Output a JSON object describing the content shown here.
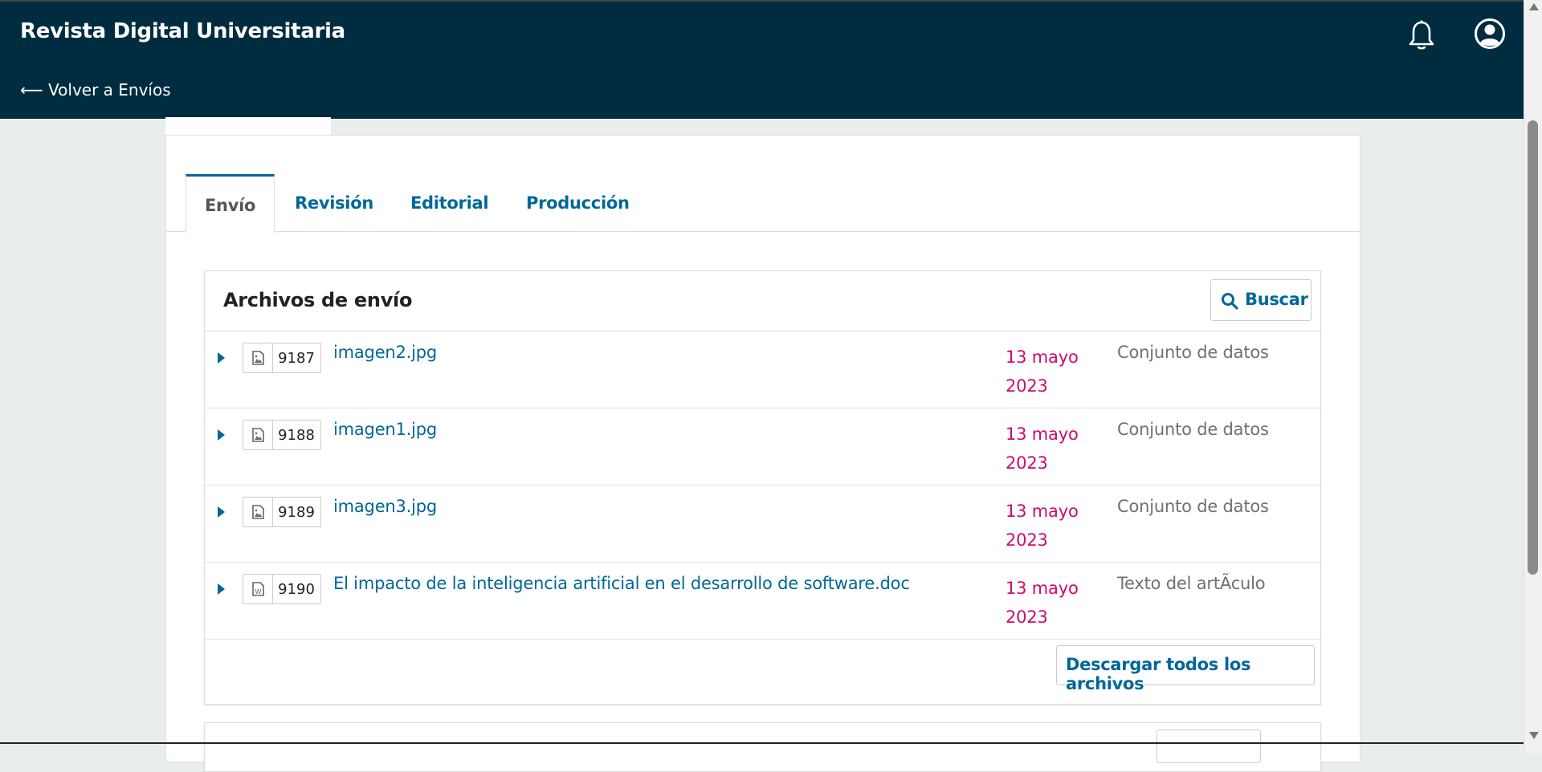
{
  "header": {
    "site_title": "Revista Digital Universitaria",
    "back_link": "⟵ Volver a Envíos",
    "icons": [
      "bell-icon",
      "user-account-icon"
    ]
  },
  "tabs": [
    {
      "label": "Envío",
      "active": true
    },
    {
      "label": "Revisión",
      "active": false
    },
    {
      "label": "Editorial",
      "active": false
    },
    {
      "label": "Producción",
      "active": false
    }
  ],
  "files_panel": {
    "title": "Archivos de envío",
    "search_label": "Buscar",
    "download_all_label": "Descargar todos los archivos",
    "rows": [
      {
        "id": "9187",
        "name": "imagen2.jpg",
        "date": "13 mayo 2023",
        "type": "Conjunto de datos",
        "icon": "image-file-icon"
      },
      {
        "id": "9188",
        "name": "imagen1.jpg",
        "date": "13 mayo 2023",
        "type": "Conjunto de datos",
        "icon": "image-file-icon"
      },
      {
        "id": "9189",
        "name": "imagen3.jpg",
        "date": "13 mayo 2023",
        "type": "Conjunto de datos",
        "icon": "image-file-icon"
      },
      {
        "id": "9190",
        "name": "El impacto de la inteligencia artificial en el desarrollo de software.doc",
        "date": "13 mayo 2023",
        "type": "Texto del artÃculo",
        "icon": "word-file-icon"
      }
    ]
  },
  "colors": {
    "header_bg": "#002c40",
    "link": "#006798",
    "date": "#d00a6c",
    "muted": "#707070"
  }
}
